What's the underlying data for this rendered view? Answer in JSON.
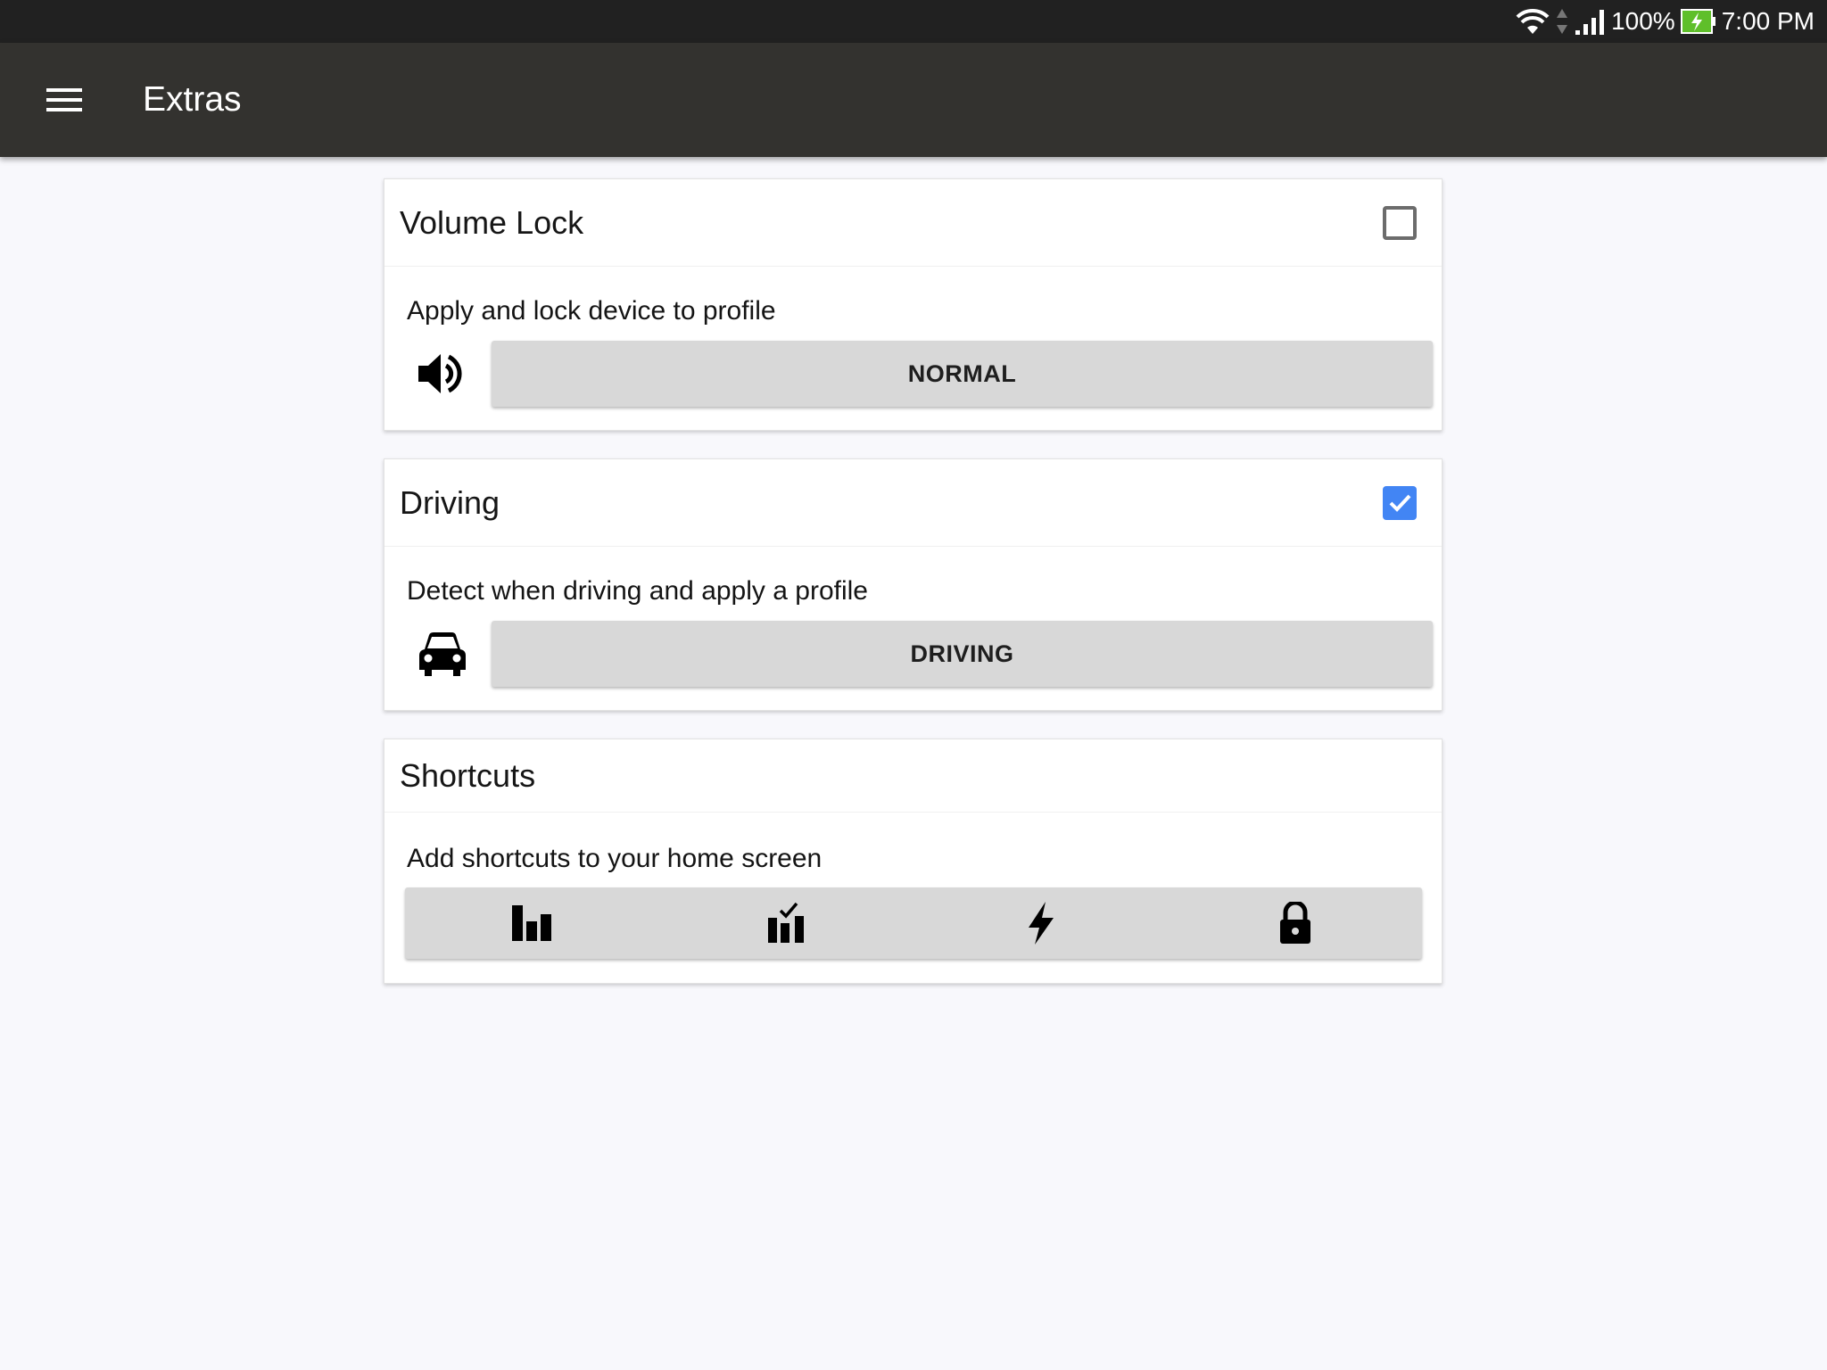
{
  "status_bar": {
    "battery": "100%",
    "time": "7:00 PM",
    "icons": [
      "wifi-icon",
      "data-arrows-icon",
      "signal-icon",
      "battery-charging-icon"
    ]
  },
  "app_bar": {
    "title": "Extras",
    "menu_icon": "hamburger-menu-icon"
  },
  "cards": {
    "volume_lock": {
      "title": "Volume Lock",
      "checked": false,
      "description": "Apply and lock device to profile",
      "icon": "volume-icon",
      "button_label": "NORMAL"
    },
    "driving": {
      "title": "Driving",
      "checked": true,
      "description": "Detect when driving and apply a profile",
      "icon": "car-icon",
      "button_label": "DRIVING"
    },
    "shortcuts": {
      "title": "Shortcuts",
      "description": "Add shortcuts to your home screen",
      "items": [
        "bar-chart-icon",
        "bar-chart-check-icon",
        "flash-icon",
        "lock-icon"
      ]
    }
  },
  "colors": {
    "status_bar": "#212121",
    "app_bar": "#33322f",
    "background": "#f8f8fc",
    "checkbox_checked": "#4285f4",
    "button_bg": "#d8d8d8",
    "battery_green": "#5fbf2a"
  }
}
